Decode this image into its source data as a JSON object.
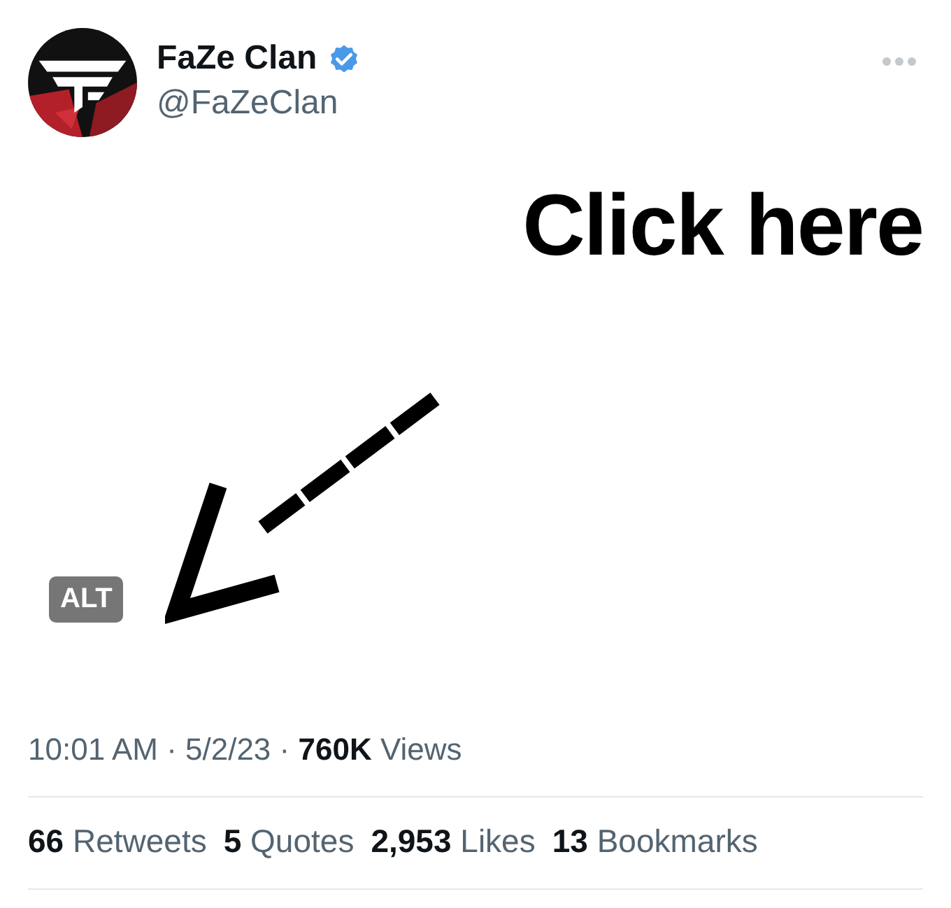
{
  "author": {
    "name": "FaZe Clan",
    "handle": "@FaZeClan",
    "verified": true
  },
  "media": {
    "caption": "Click here",
    "alt_badge": "ALT"
  },
  "meta": {
    "time": "10:01 AM",
    "separator_1": "·",
    "date": "5/2/23",
    "separator_2": "·",
    "views_count": "760K",
    "views_label": "Views"
  },
  "stats": [
    {
      "count": "66",
      "label": "Retweets"
    },
    {
      "count": "5",
      "label": "Quotes"
    },
    {
      "count": "2,953",
      "label": "Likes"
    },
    {
      "count": "13",
      "label": "Bookmarks"
    }
  ]
}
